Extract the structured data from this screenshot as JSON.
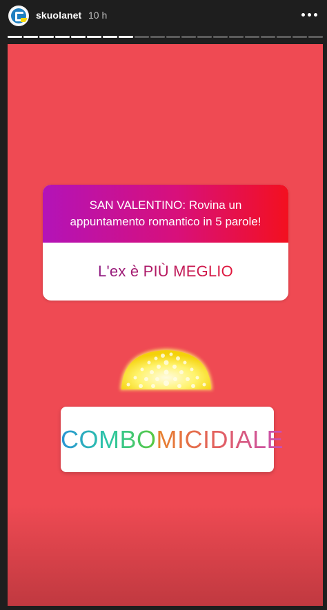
{
  "header": {
    "username": "skuolanet",
    "time": "10 h",
    "avatar_icon": "skuolanet-logo-icon",
    "more_icon": "more-horizontal-icon"
  },
  "progress": {
    "total_segments": 20,
    "viewed_segments": 8
  },
  "question_sticker": {
    "prompt": "SAN VALENTINO: Rovina un appuntamento romantico in 5 parole!",
    "answer": "L'ex è PIÙ MEGLIO"
  },
  "decoration": {
    "icon": "glowing-dome-sticker"
  },
  "combo_sticker": {
    "left": "COMBO",
    "right": "MICIDIALE"
  },
  "colors": {
    "background": "#ef4a53",
    "question_gradient_start": "#b313b8",
    "question_gradient_end": "#f3101f"
  }
}
